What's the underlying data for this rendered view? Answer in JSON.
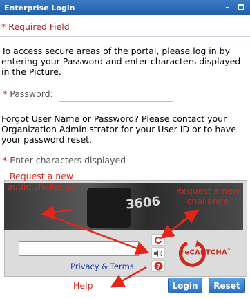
{
  "window": {
    "title": "Enterprise Login",
    "minimize_glyph": "–",
    "maximize_icon": "maximize-icon"
  },
  "required_note": "* Required Field",
  "intro_text": "To access secure areas of the portal, please log in by entering your Password and enter characters displayed in the Picture.",
  "password": {
    "label": "Password:",
    "star": "*",
    "value": "",
    "placeholder": ""
  },
  "forgot_text": "Forgot User Name or Password? Please contact your Organization Administrator for your User ID or to have your password reset.",
  "captcha": {
    "label": "Enter characters displayed",
    "star": "*",
    "image_number": "3606",
    "input_value": "",
    "privacy_link": "Privacy & Terms",
    "logo_text": "reCAPTCHA",
    "logo_tm": "™",
    "icons": [
      "refresh-icon",
      "audio-icon",
      "help-icon"
    ]
  },
  "annotations": {
    "audio": "Request a new audio challenge",
    "new_challenge": "Request a new challenge",
    "help": "Help"
  },
  "buttons": {
    "login": "Login",
    "reset": "Reset"
  },
  "colors": {
    "title_bar": "#1f5ea8",
    "required_red": "#b02020",
    "annotation_red": "#cc2a1e",
    "button_blue": "#2a6fbf",
    "link_blue": "#1a3fa8"
  }
}
